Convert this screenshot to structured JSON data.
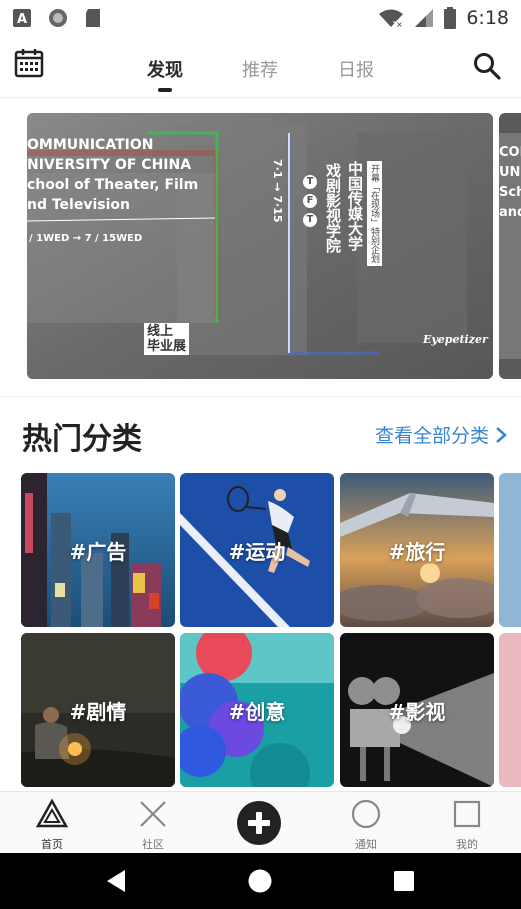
{
  "status_bar": {
    "time": "6:18",
    "left_icons": [
      "a-notification-icon",
      "circle-notification-icon",
      "sd-card-icon"
    ],
    "right_icons": [
      "wifi-icon",
      "signal-icon",
      "battery-icon"
    ]
  },
  "top_nav": {
    "tabs": [
      {
        "label": "发现",
        "active": true
      },
      {
        "label": "推荐",
        "active": false
      },
      {
        "label": "日报",
        "active": false
      }
    ],
    "left_icon": "calendar-icon",
    "right_icon": "search-icon"
  },
  "banner": {
    "en_lines": [
      "OMMUNICATION",
      "NIVERSITY OF CHINA",
      "chool of Theater, Film",
      "nd Television"
    ],
    "date_range": "/ 1WED  →  7 / 15WED",
    "vertical_date": "7·1 → 7·15",
    "vertical_cn_1": "中国传媒大学",
    "vertical_cn_2": "戏剧影视学院",
    "vertical_cn_3": "开幕「在现场」特别企划",
    "badge_line1": "线上",
    "badge_line2": "毕业展",
    "brand": "Eyepetizer",
    "tft": [
      "T",
      "F",
      "T"
    ],
    "next_en_lines": [
      "COI",
      "UNI",
      "Sch",
      "and"
    ]
  },
  "section": {
    "title": "热门分类",
    "see_all": "查看全部分类"
  },
  "categories": [
    {
      "label": "#广告"
    },
    {
      "label": "#运动"
    },
    {
      "label": "#旅行"
    },
    {
      "label": "#剧情"
    },
    {
      "label": "#创意"
    },
    {
      "label": "#影视"
    }
  ],
  "bottom_tabs": [
    {
      "label": "首页",
      "icon": "triangle-home-icon",
      "active": true
    },
    {
      "label": "社区",
      "icon": "cross-community-icon",
      "active": false
    },
    {
      "label": "",
      "icon": "plus-create-icon",
      "active": false
    },
    {
      "label": "通知",
      "icon": "circle-notification-icon",
      "active": false
    },
    {
      "label": "我的",
      "icon": "square-profile-icon",
      "active": false
    }
  ],
  "colors": {
    "accent_link": "#3a86d4",
    "text_primary": "#222222",
    "text_secondary": "#9a9a9a"
  }
}
